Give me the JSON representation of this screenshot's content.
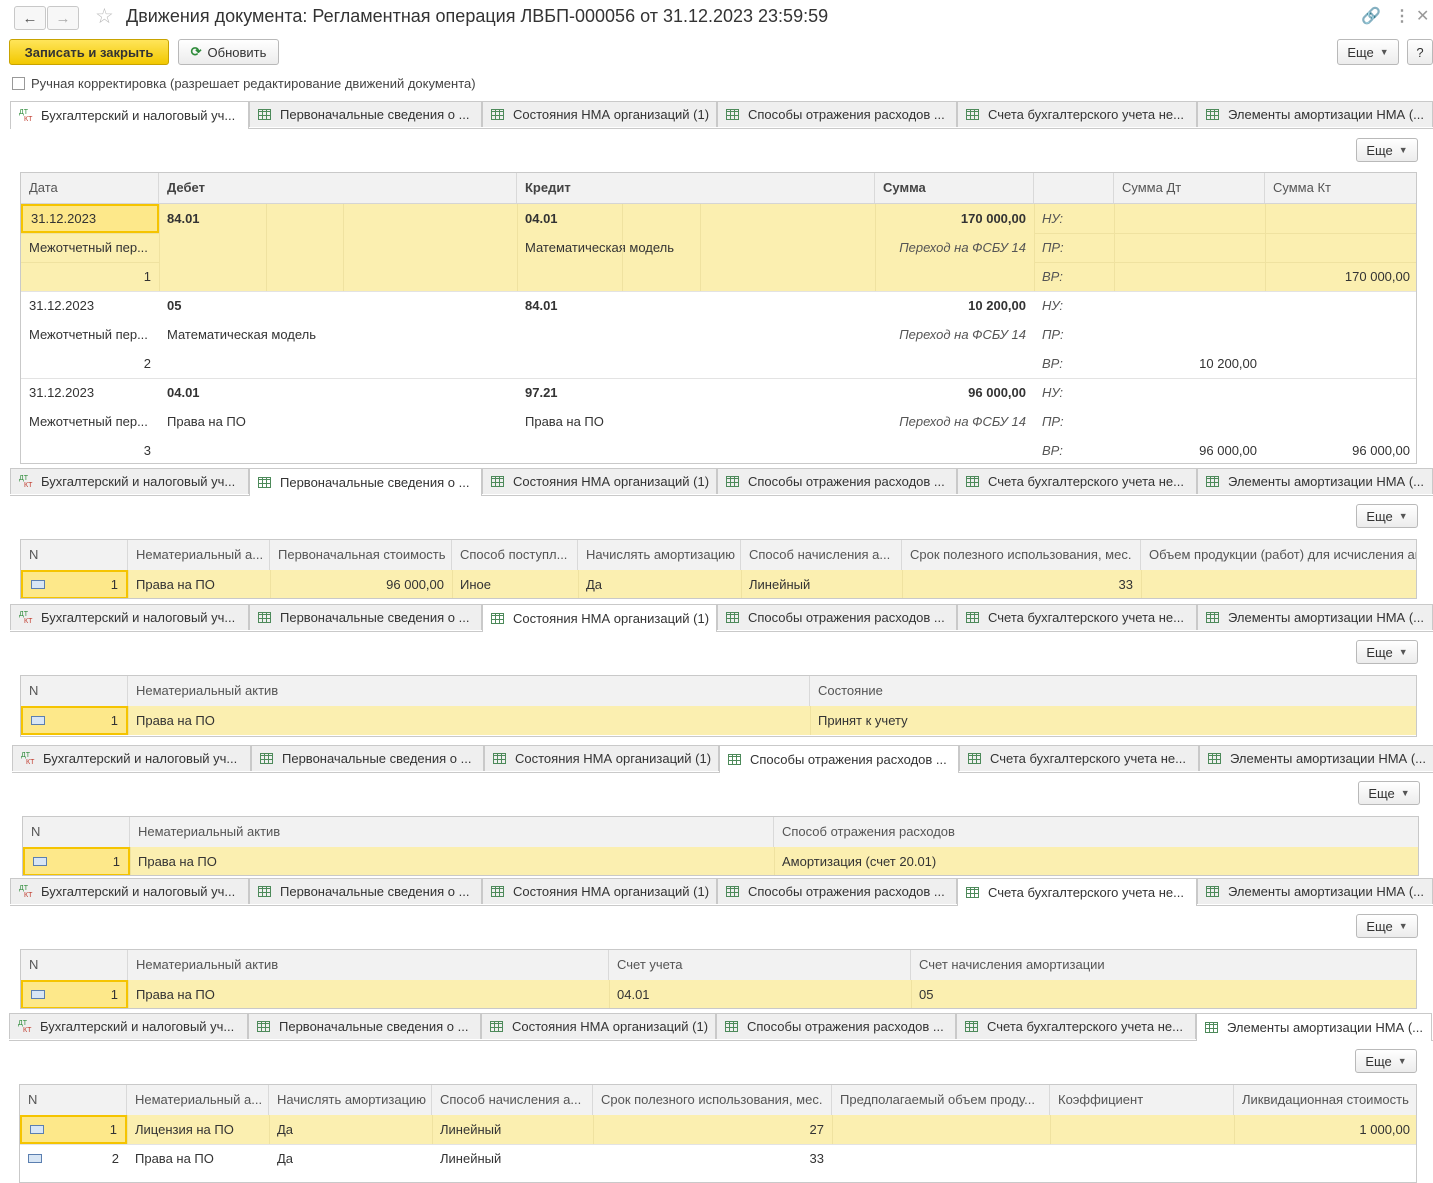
{
  "header": {
    "title": "Движения документа: Регламентная операция ЛВБП-000056 от 31.12.2023 23:59:59",
    "save_close": "Записать и закрыть",
    "refresh": "Обновить",
    "more": "Еще",
    "help": "?"
  },
  "manual_edit": "Ручная корректировка (разрешает редактирование движений документа)",
  "tabs": [
    "Бухгалтерский и налоговый уч...",
    "Первоначальные сведения о ...",
    "Состояния НМА организаций (1)",
    "Способы отражения расходов ...",
    "Счета бухгалтерского учета не...",
    "Элементы амортизации НМА (..."
  ],
  "more_label": "Еще",
  "dtkt": {
    "dt": "ДТ",
    "kt": "КТ"
  },
  "acc": {
    "headers": [
      "Дата",
      "Дебет",
      "Кредит",
      "Сумма",
      "",
      "Сумма Дт",
      "Сумма Кт"
    ],
    "labels": {
      "nu": "НУ:",
      "pr": "ПР:",
      "vr": "ВР:"
    },
    "rows": [
      {
        "date": "31.12.2023",
        "period": "Межотчетный пер...",
        "n": "1",
        "debit": "84.01",
        "debit_sub": "",
        "credit": "04.01",
        "credit_sub": "Математическая модель",
        "sum": "170 000,00",
        "content": "Переход на ФСБУ 14",
        "vr_dt": "",
        "vr_kt": "170 000,00"
      },
      {
        "date": "31.12.2023",
        "period": "Межотчетный пер...",
        "n": "2",
        "debit": "05",
        "debit_sub": "Математическая модель",
        "credit": "84.01",
        "credit_sub": "",
        "sum": "10 200,00",
        "content": "Переход на ФСБУ 14",
        "vr_dt": "10 200,00",
        "vr_kt": ""
      },
      {
        "date": "31.12.2023",
        "period": "Межотчетный пер...",
        "n": "3",
        "debit": "04.01",
        "debit_sub": "Права на ПО",
        "credit": "97.21",
        "credit_sub": "Права на ПО",
        "sum": "96 000,00",
        "content": "Переход на ФСБУ 14",
        "vr_dt": "96 000,00",
        "vr_kt": "96 000,00"
      }
    ]
  },
  "initial": {
    "headers": [
      "N",
      "Нематериальный а...",
      "Первоначальная стоимость",
      "Способ поступл...",
      "Начислять амортизацию",
      "Способ начисления а...",
      "Срок полезного использования, мес.",
      "Объем продукции (работ) для исчисления ам"
    ],
    "row": [
      "1",
      "Права на ПО",
      "96 000,00",
      "Иное",
      "Да",
      "Линейный",
      "33",
      ""
    ]
  },
  "states": {
    "headers": [
      "N",
      "Нематериальный актив",
      "Состояние"
    ],
    "row": [
      "1",
      "Права на ПО",
      "Принят к учету"
    ]
  },
  "expenses": {
    "headers": [
      "N",
      "Нематериальный актив",
      "Способ отражения расходов"
    ],
    "row": [
      "1",
      "Права на ПО",
      "Амортизация (счет 20.01)"
    ]
  },
  "accounts": {
    "headers": [
      "N",
      "Нематериальный актив",
      "Счет учета",
      "Счет начисления амортизации"
    ],
    "row": [
      "1",
      "Права на ПО",
      "04.01",
      "05"
    ]
  },
  "amort": {
    "headers": [
      "N",
      "Нематериальный а...",
      "Начислять амортизацию",
      "Способ начисления а...",
      "Срок полезного использования, мес.",
      "Предполагаемый объем проду...",
      "Коэффициент",
      "Ликвидационная стоимость"
    ],
    "rows": [
      [
        "1",
        "Лицензия на ПО",
        "Да",
        "Линейный",
        "27",
        "",
        "",
        "1 000,00"
      ],
      [
        "2",
        "Права на ПО",
        "Да",
        "Линейный",
        "33",
        "",
        "",
        ""
      ]
    ]
  }
}
